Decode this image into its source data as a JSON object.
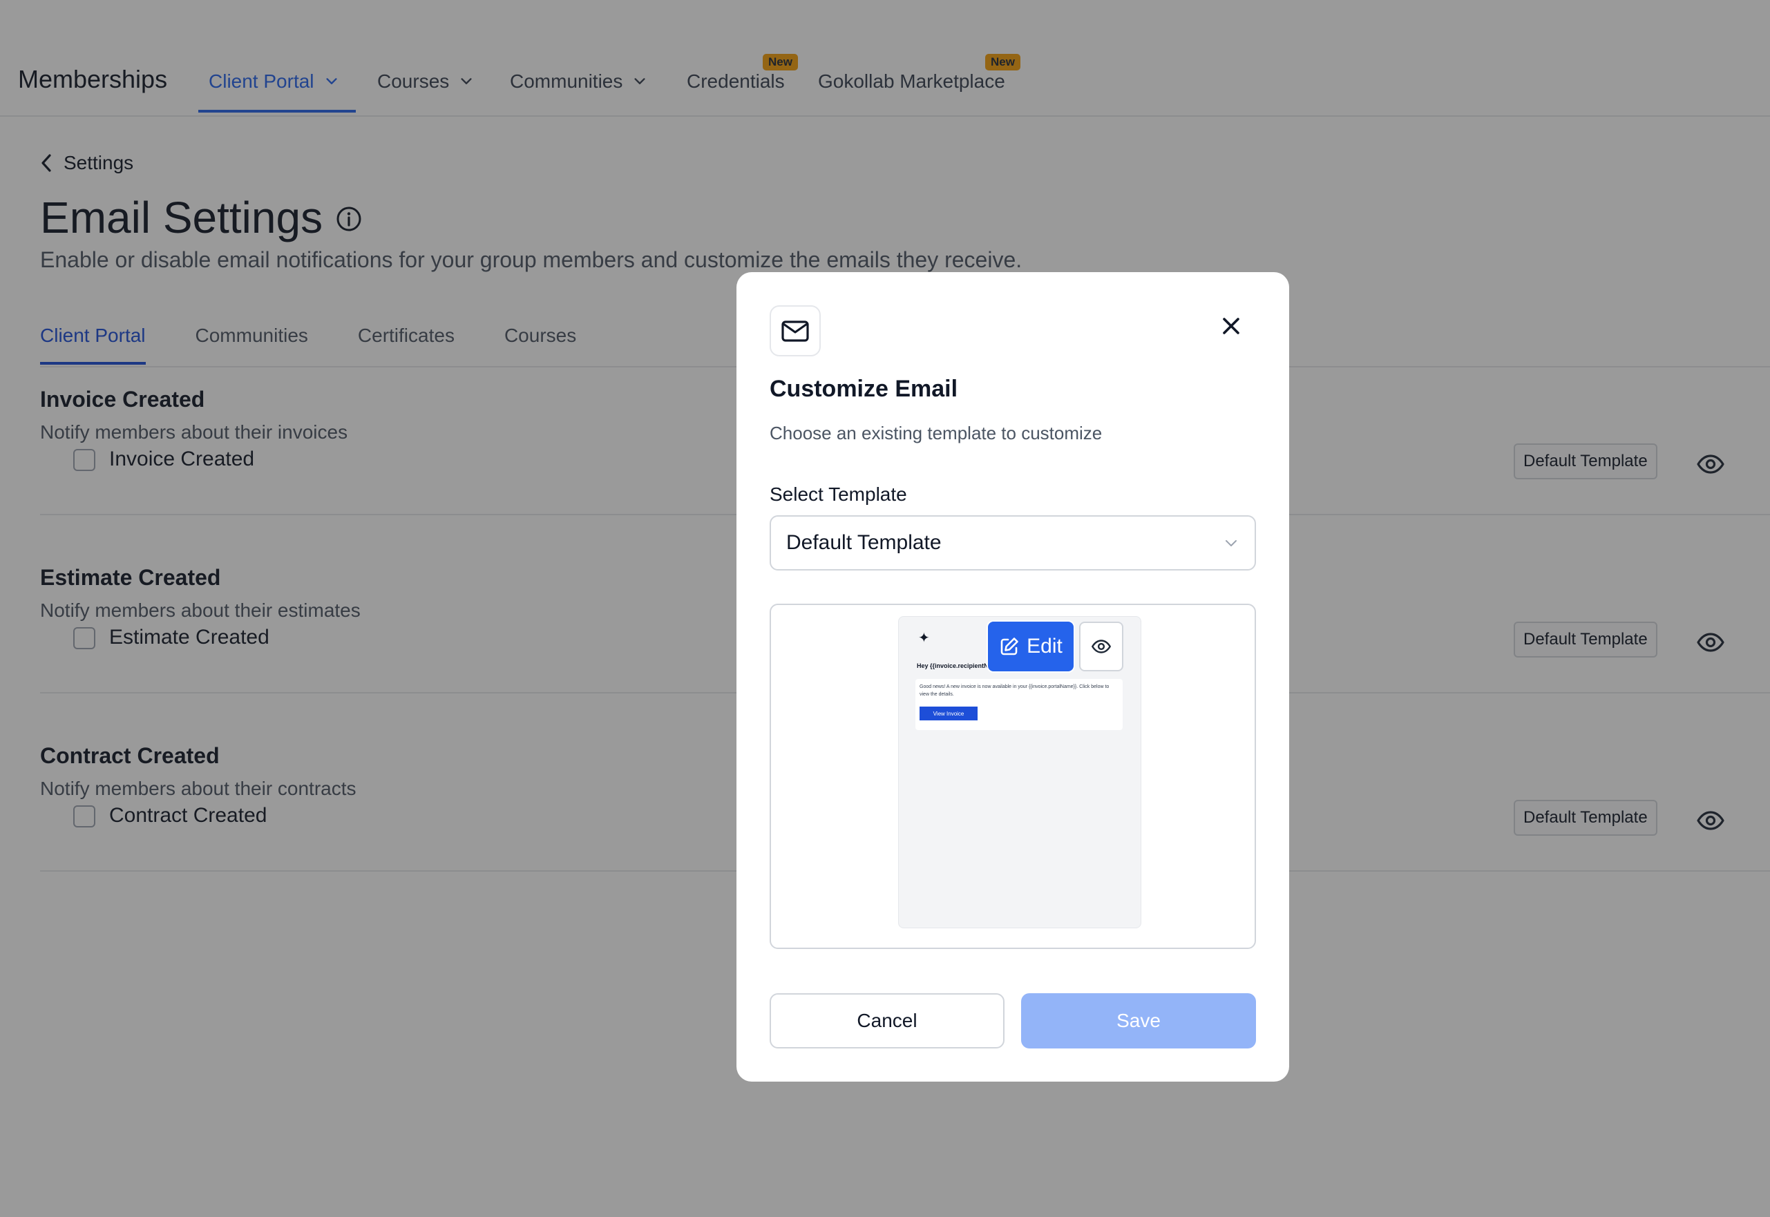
{
  "app": {
    "brand": "Memberships"
  },
  "nav": {
    "items": [
      {
        "label": "Client Portal",
        "has_dropdown": true,
        "active": true
      },
      {
        "label": "Courses",
        "has_dropdown": true
      },
      {
        "label": "Communities",
        "has_dropdown": true
      },
      {
        "label": "Credentials",
        "badge": "New"
      },
      {
        "label": "Gokollab Marketplace",
        "badge": "New"
      }
    ]
  },
  "page": {
    "back_label": "Settings",
    "title": "Email Settings",
    "subtitle": "Enable or disable email notifications for your group members and customize the emails they receive."
  },
  "tabs": [
    {
      "label": "Client Portal",
      "active": true
    },
    {
      "label": "Communities"
    },
    {
      "label": "Certificates"
    },
    {
      "label": "Courses"
    }
  ],
  "sections": [
    {
      "title": "Invoice Created",
      "description": "Notify members about their invoices",
      "checkbox_label": "Invoice Created",
      "checked": false,
      "template": "Default Template"
    },
    {
      "title": "Estimate Created",
      "description": "Notify members about their estimates",
      "checkbox_label": "Estimate Created",
      "checked": false,
      "template": "Default Template"
    },
    {
      "title": "Contract Created",
      "description": "Notify members about their contracts",
      "checkbox_label": "Contract Created",
      "checked": false,
      "template": "Default Template"
    }
  ],
  "modal": {
    "icon": "mail-icon",
    "title": "Customize Email",
    "description": "Choose an existing template to customize",
    "select_label": "Select Template",
    "select_value": "Default Template",
    "preview": {
      "greeting": "Hey {{invoice.recipientName}},",
      "body": "Good news! A new invoice is now available in your {{invoice.portalName}}. Click below to view the details.",
      "cta": "View Invoice"
    },
    "edit_label": "Edit",
    "cancel_label": "Cancel",
    "save_label": "Save"
  },
  "colors": {
    "accent": "#2563eb",
    "badge": "#f59e0b",
    "save_disabled": "#93b4f8"
  }
}
